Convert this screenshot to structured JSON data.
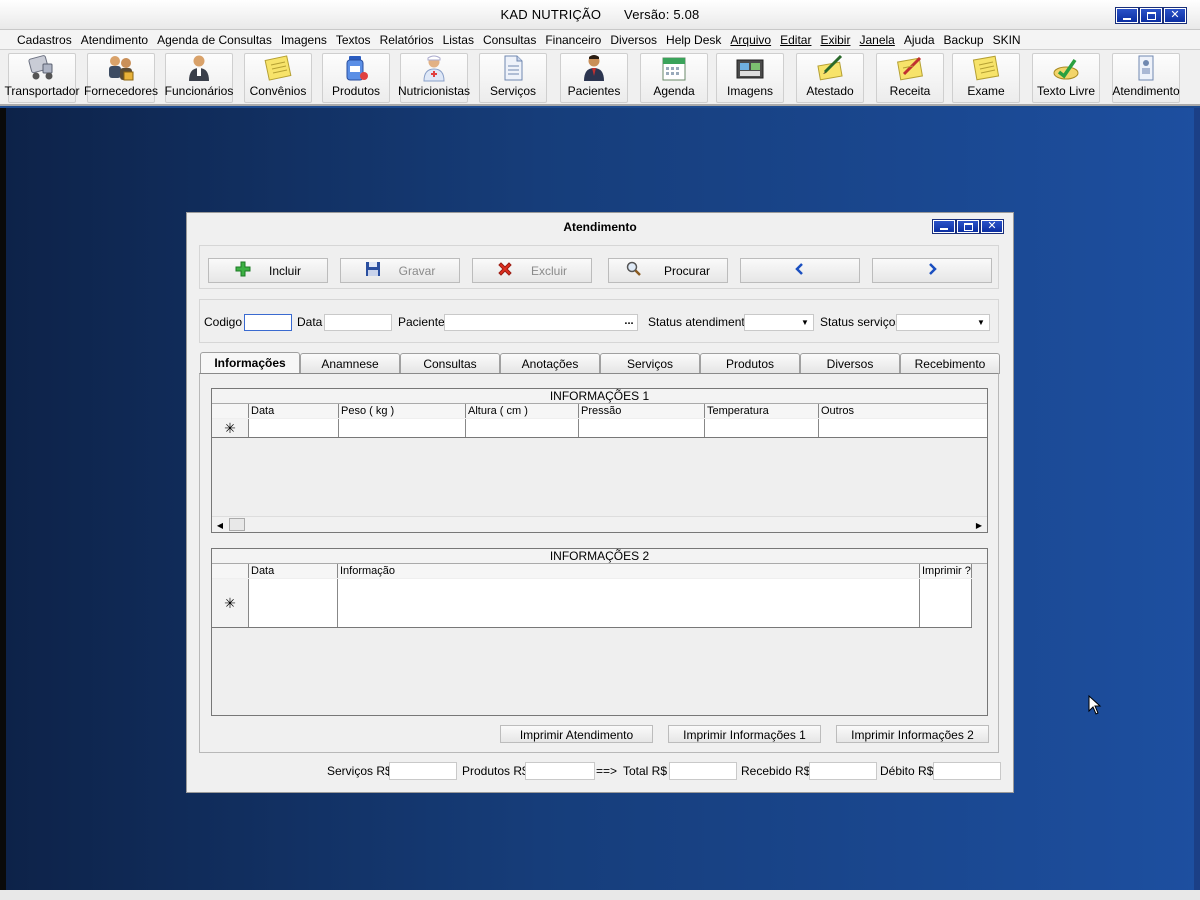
{
  "app": {
    "title": "KAD NUTRIÇÃO      Versão: 5.08"
  },
  "menu": [
    "Cadastros",
    "Atendimento",
    "Agenda de Consultas",
    "Imagens",
    "Textos",
    "Relatórios",
    "Listas",
    "Consultas",
    "Financeiro",
    "Diversos",
    "Help Desk",
    "Arquivo",
    "Editar",
    "Exibir",
    "Janela",
    "Ajuda",
    "Backup",
    "SKIN"
  ],
  "toolbar": [
    {
      "label": "Transportador",
      "icon": "truck-icon"
    },
    {
      "label": "Fornecedores",
      "icon": "suppliers-icon"
    },
    {
      "label": "Funcionários",
      "icon": "employee-icon"
    },
    {
      "label": "Convênios",
      "icon": "notepad-icon"
    },
    {
      "label": "Produtos",
      "icon": "medicine-icon"
    },
    {
      "label": "Nutricionistas",
      "icon": "nurse-icon"
    },
    {
      "label": "Serviços",
      "icon": "document-icon"
    },
    {
      "label": "Pacientes",
      "icon": "patient-icon"
    },
    {
      "label": "Agenda",
      "icon": "calendar-icon"
    },
    {
      "label": "Imagens",
      "icon": "images-icon"
    },
    {
      "label": "Atestado",
      "icon": "pen-paper-icon"
    },
    {
      "label": "Receita",
      "icon": "prescription-icon"
    },
    {
      "label": "Exame",
      "icon": "exam-icon"
    },
    {
      "label": "Texto Livre",
      "icon": "free-text-icon"
    },
    {
      "label": "Atendimento",
      "icon": "attendance-icon"
    }
  ],
  "window": {
    "title": "Atendimento",
    "actions": {
      "incluir": "Incluir",
      "gravar": "Gravar",
      "excluir": "Excluir",
      "procurar": "Procurar"
    },
    "fields": {
      "codigo": "Codigo",
      "data": "Data",
      "paciente": "Paciente",
      "paciente_lookup": "...",
      "status_atendimento": "Status atendimento",
      "status_servicos": "Status serviços"
    },
    "tabs": [
      "Informações",
      "Anamnese",
      "Consultas",
      "Anotações",
      "Serviços",
      "Produtos",
      "Diversos",
      "Recebimento"
    ],
    "active_tab": "Informações",
    "grid1": {
      "caption": "INFORMAÇÕES 1",
      "columns": [
        "Data",
        "Peso ( kg )",
        "Altura ( cm )",
        "Pressão",
        "Temperatura",
        "Outros"
      ],
      "new_row_marker": "✳"
    },
    "grid2": {
      "caption": "INFORMAÇÕES 2",
      "columns": [
        "Data",
        "Informação",
        "Imprimir ?"
      ],
      "new_row_marker": "✳"
    },
    "print_buttons": {
      "atendimento": "Imprimir Atendimento",
      "info1": "Imprimir Informações 1",
      "info2": "Imprimir Informações 2"
    },
    "totals": {
      "servicos": "Serviços R$",
      "produtos": "Produtos R$",
      "arrow": "==>",
      "total": "Total R$",
      "recebido": "Recebido R$",
      "debito": "Débito R$"
    }
  }
}
